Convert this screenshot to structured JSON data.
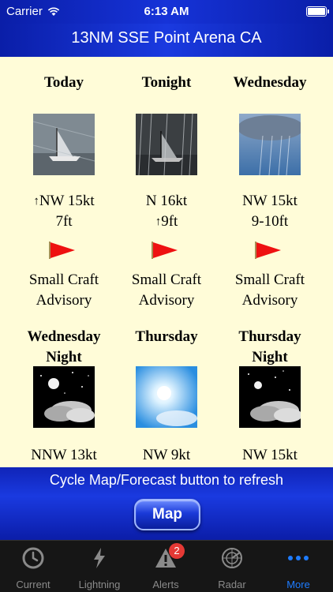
{
  "status_bar": {
    "carrier": "Carrier",
    "time": "6:13 AM"
  },
  "header": {
    "title": "13NM SSE Point Arena CA"
  },
  "forecast": {
    "periods": [
      {
        "name": "Today",
        "wind": "NW 15kt",
        "wave": "7ft",
        "advisory": [
          "Small Craft",
          "Advisory"
        ]
      },
      {
        "name": "Tonight",
        "wind": "N 16kt",
        "wave": "9ft",
        "advisory": [
          "Small Craft",
          "Advisory"
        ]
      },
      {
        "name": "Wednesday",
        "wind": "NW 15kt",
        "wave": "9-10ft",
        "advisory": [
          "Small Craft",
          "Advisory"
        ]
      },
      {
        "name": [
          "Wednesday",
          "Night"
        ],
        "wind": "NNW 13kt"
      },
      {
        "name": "Thursday",
        "wind": "NW 9kt"
      },
      {
        "name": [
          "Thursday",
          "Night"
        ],
        "wind": "NW 15kt"
      }
    ]
  },
  "bottom": {
    "refresh_text": "Cycle Map/Forecast button to refresh",
    "map_button": "Map"
  },
  "tabbar": {
    "tabs": [
      {
        "label": "Current",
        "icon": "clock-icon"
      },
      {
        "label": "Lightning",
        "icon": "lightning-icon"
      },
      {
        "label": "Alerts",
        "icon": "alert-icon",
        "badge": "2"
      },
      {
        "label": "Radar",
        "icon": "radar-icon"
      },
      {
        "label": "More",
        "icon": "more-icon"
      }
    ],
    "active_tab": "More"
  },
  "colors": {
    "bar_blue": "#1633d8",
    "forecast_bg": "#fffcd8",
    "flag_red": "#ee1111",
    "tab_active": "#1e7cff",
    "badge_red": "#e53935"
  }
}
